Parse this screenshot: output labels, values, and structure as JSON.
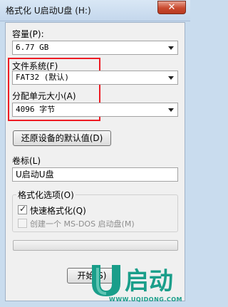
{
  "window": {
    "title": "格式化 U启动U盘 (H:)",
    "close_glyph": "✕"
  },
  "capacity": {
    "label": "容量(P):",
    "value": "6.77 GB"
  },
  "filesystem": {
    "label": "文件系统(F)",
    "value": "FAT32 (默认)"
  },
  "alloc": {
    "label": "分配单元大小(A)",
    "value": "4096 字节"
  },
  "restore_button": "还原设备的默认值(D)",
  "volume": {
    "label": "卷标(L)",
    "value": "U启动U盘"
  },
  "options": {
    "title": "格式化选项(O)",
    "quick_format": {
      "label": "快速格式化(Q)",
      "checked": true
    },
    "msdos": {
      "label": "创建一个 MS-DOS 启动盘(M)",
      "checked": false,
      "enabled": false
    }
  },
  "start_button": "开始(S)",
  "watermark": {
    "logo_text": "启动",
    "url": "WWW.UQIDONG.COM"
  },
  "colors": {
    "highlight": "#ee1c24",
    "brand": "#1a9e8a"
  }
}
